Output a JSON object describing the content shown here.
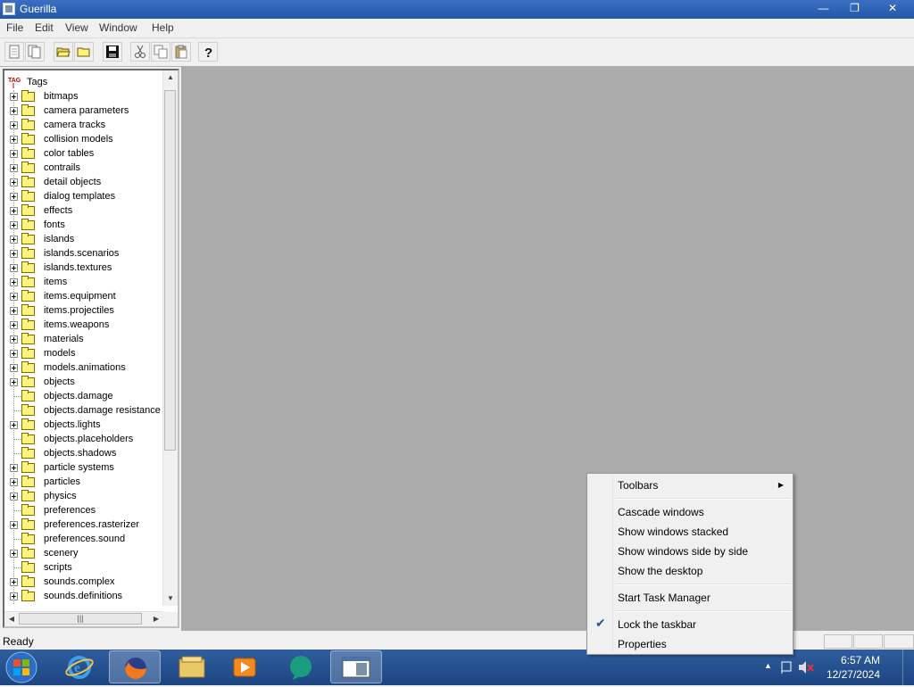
{
  "window": {
    "title": "Guerilla",
    "minimize": "—",
    "restore": "❐",
    "close": "✕"
  },
  "menubar": [
    "File",
    "Edit",
    "View",
    "Window",
    "Help"
  ],
  "tree": {
    "root_label": "Tags",
    "items": [
      {
        "label": "bitmaps",
        "expandable": true
      },
      {
        "label": "camera parameters",
        "expandable": true
      },
      {
        "label": "camera tracks",
        "expandable": true
      },
      {
        "label": "collision models",
        "expandable": true
      },
      {
        "label": "color tables",
        "expandable": true
      },
      {
        "label": "contrails",
        "expandable": true
      },
      {
        "label": "detail objects",
        "expandable": true
      },
      {
        "label": "dialog templates",
        "expandable": true
      },
      {
        "label": "effects",
        "expandable": true
      },
      {
        "label": "fonts",
        "expandable": true
      },
      {
        "label": "islands",
        "expandable": true
      },
      {
        "label": "islands.scenarios",
        "expandable": true
      },
      {
        "label": "islands.textures",
        "expandable": true
      },
      {
        "label": "items",
        "expandable": true
      },
      {
        "label": "items.equipment",
        "expandable": true
      },
      {
        "label": "items.projectiles",
        "expandable": true
      },
      {
        "label": "items.weapons",
        "expandable": true
      },
      {
        "label": "materials",
        "expandable": true
      },
      {
        "label": "models",
        "expandable": true
      },
      {
        "label": "models.animations",
        "expandable": true
      },
      {
        "label": "objects",
        "expandable": true
      },
      {
        "label": "objects.damage",
        "expandable": false
      },
      {
        "label": "objects.damage resistance",
        "expandable": false
      },
      {
        "label": "objects.lights",
        "expandable": true
      },
      {
        "label": "objects.placeholders",
        "expandable": false
      },
      {
        "label": "objects.shadows",
        "expandable": false
      },
      {
        "label": "particle systems",
        "expandable": true
      },
      {
        "label": "particles",
        "expandable": true
      },
      {
        "label": "physics",
        "expandable": true
      },
      {
        "label": "preferences",
        "expandable": false
      },
      {
        "label": "preferences.rasterizer",
        "expandable": true
      },
      {
        "label": "preferences.sound",
        "expandable": false
      },
      {
        "label": "scenery",
        "expandable": true
      },
      {
        "label": "scripts",
        "expandable": false
      },
      {
        "label": "sounds.complex",
        "expandable": true
      },
      {
        "label": "sounds.definitions",
        "expandable": true
      }
    ]
  },
  "status": {
    "text": "Ready"
  },
  "taskbar": {
    "clock_time": "6:57 AM",
    "clock_date": "12/27/2024",
    "apps": [
      "internet-explorer",
      "firefox",
      "file-explorer",
      "media-player",
      "feedback-app",
      "guerilla"
    ]
  },
  "context_menu": {
    "items": [
      {
        "label": "Toolbars",
        "submenu": true
      },
      {
        "label": "Cascade windows"
      },
      {
        "label": "Show windows stacked"
      },
      {
        "label": "Show windows side by side"
      },
      {
        "label": "Show the desktop"
      },
      {
        "label": "Start Task Manager"
      },
      {
        "label": "Lock the taskbar",
        "checked": true
      },
      {
        "label": "Properties"
      }
    ]
  },
  "colors": {
    "titlebar": "#2a60b4",
    "mdi_background": "#ababab",
    "taskbar": "#245290",
    "folder": "#fff27a"
  }
}
